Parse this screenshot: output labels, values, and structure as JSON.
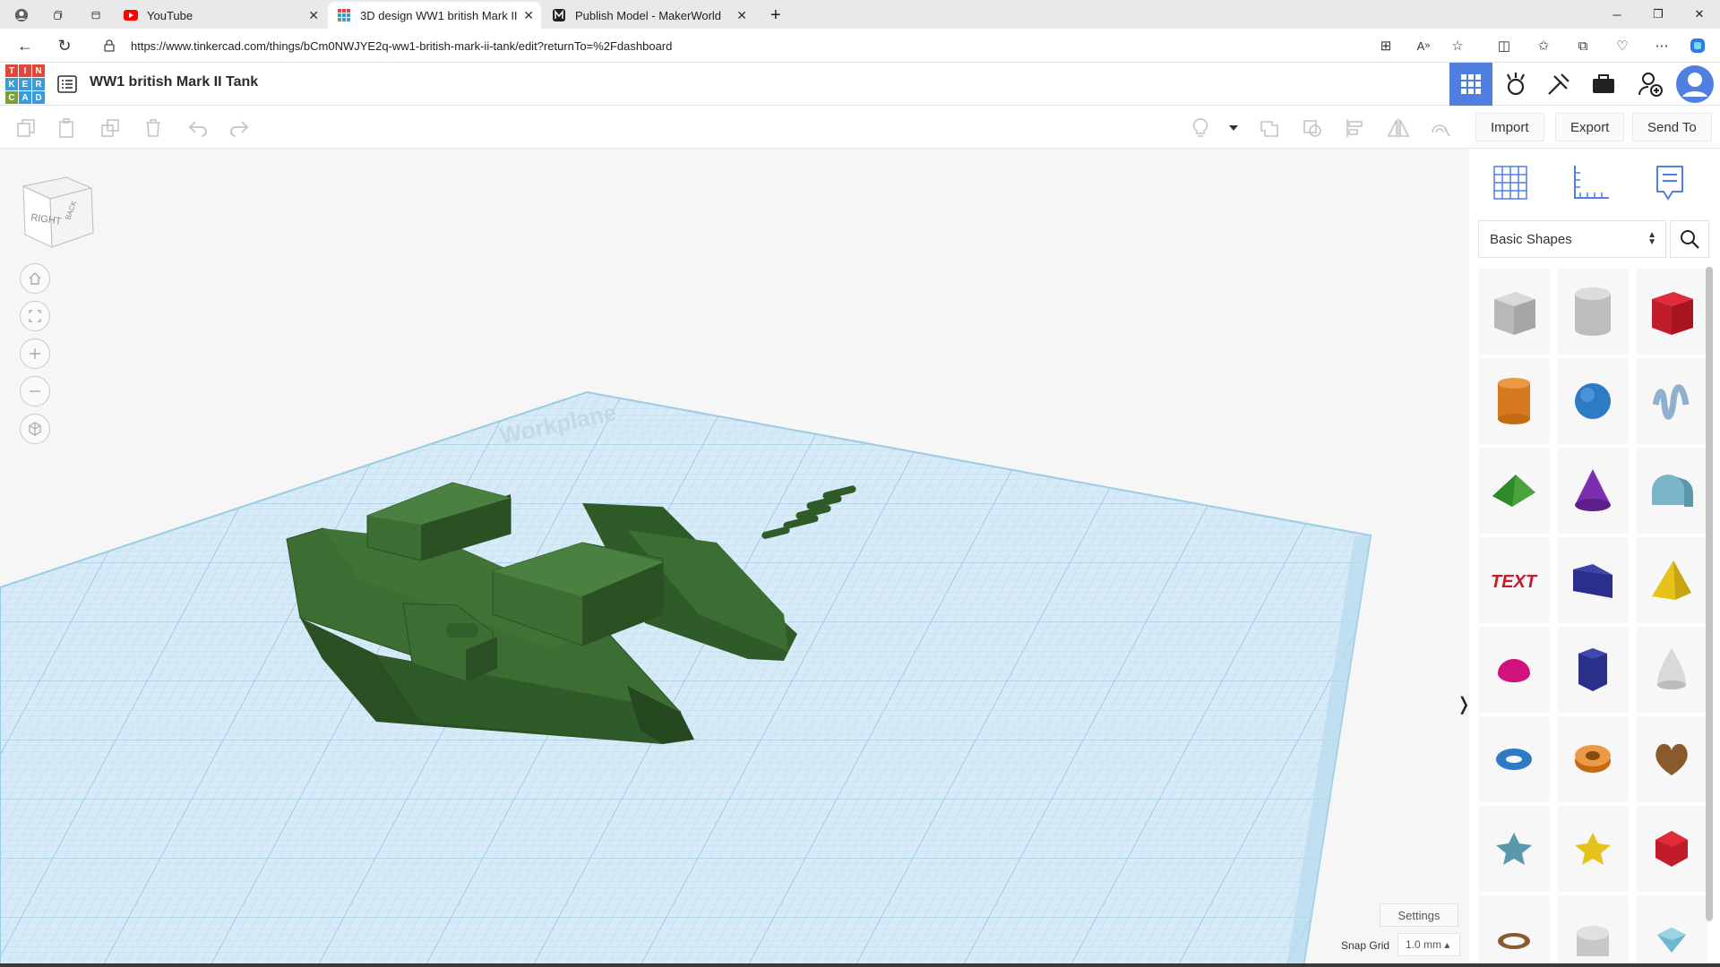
{
  "browser": {
    "tabs": [
      {
        "title": "YouTube",
        "icon": "youtube-icon",
        "active": false
      },
      {
        "title": "3D design WW1 british Mark II T...",
        "icon": "tinkercad-icon",
        "active": true
      },
      {
        "title": "Publish Model - MakerWorld",
        "icon": "makerworld-icon",
        "active": false
      }
    ],
    "new_tab": "+",
    "url": "https://www.tinkercad.com/things/bCm0NWJYE2q-ww1-british-mark-ii-tank/edit?returnTo=%2Fdashboard"
  },
  "tinkercad": {
    "logo_letters": [
      "T",
      "I",
      "N",
      "K",
      "E",
      "R",
      "C",
      "A",
      "D"
    ],
    "logo_colors": [
      "#e2473b",
      "#e2473b",
      "#e2473b",
      "#3a9bd8",
      "#3a9bd8",
      "#3a9bd8",
      "#7b9e3a",
      "#3a9bd8",
      "#3a9bd8"
    ],
    "design_title": "WW1 british Mark II Tank",
    "header_icons": [
      "grid-view-icon",
      "tinker-icon",
      "build-icon",
      "briefcase-icon",
      "add-user-icon",
      "avatar"
    ],
    "toolbar": {
      "import_label": "Import",
      "export_label": "Export",
      "send_to_label": "Send To"
    },
    "viewcube": {
      "front": "RIGHT",
      "side": "BACK"
    },
    "viewport": {
      "settings_label": "Settings",
      "snap_grid_label": "Snap Grid",
      "snap_grid_value": "1.0 mm ▴",
      "workplane_watermark": "Workplane",
      "model_color": "#3c6e33"
    },
    "panel": {
      "category": "Basic Shapes",
      "icons": [
        "workplane-grid-icon",
        "ruler-icon",
        "notes-icon"
      ],
      "shapes": [
        "box-hole-shape",
        "cylinder-hole-shape",
        "box-shape",
        "cylinder-shape",
        "sphere-shape",
        "scribble-shape",
        "roof-shape",
        "cone-shape",
        "round-roof-shape",
        "text-shape",
        "wedge-shape",
        "pyramid-shape",
        "half-sphere-shape",
        "polygon-shape",
        "paraboloid-shape",
        "torus-shape",
        "tube-shape",
        "heart-shape",
        "star-shape",
        "star-yellow-shape",
        "icosahedron-shape",
        "ring-shape",
        "tube-grey-shape",
        "gem-shape"
      ]
    }
  }
}
